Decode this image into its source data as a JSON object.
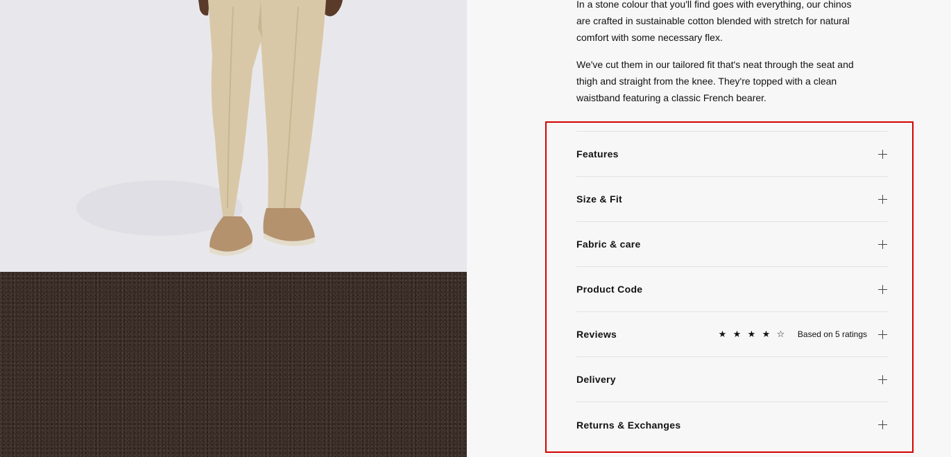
{
  "description": {
    "paragraph_1": "In a stone colour that you'll find goes with everything, our chinos are crafted in sustainable cotton blended with stretch for natural comfort with some necessary flex.",
    "paragraph_2": "We've cut them in our tailored fit that's neat through the seat and thigh and straight from the knee. They're topped with a clean waistband featuring a classic French bearer."
  },
  "accordion": {
    "items": [
      {
        "label": "Features",
        "icon": "plus-icon"
      },
      {
        "label": "Size & Fit",
        "icon": "plus-icon"
      },
      {
        "label": "Fabric & care",
        "icon": "plus-icon"
      },
      {
        "label": "Product Code",
        "icon": "plus-icon"
      },
      {
        "label": "Reviews",
        "icon": "plus-icon",
        "rating": 4,
        "rating_max": 5,
        "rating_text": "Based on 5 ratings"
      },
      {
        "label": "Delivery",
        "icon": "plus-icon"
      },
      {
        "label": "Returns & Exchanges",
        "icon": "plus-icon"
      }
    ]
  },
  "colors": {
    "highlight": "#d40000",
    "trouser": "#d9c8a7",
    "shoe": "#b4926e",
    "fabric": "#3b2d26"
  }
}
